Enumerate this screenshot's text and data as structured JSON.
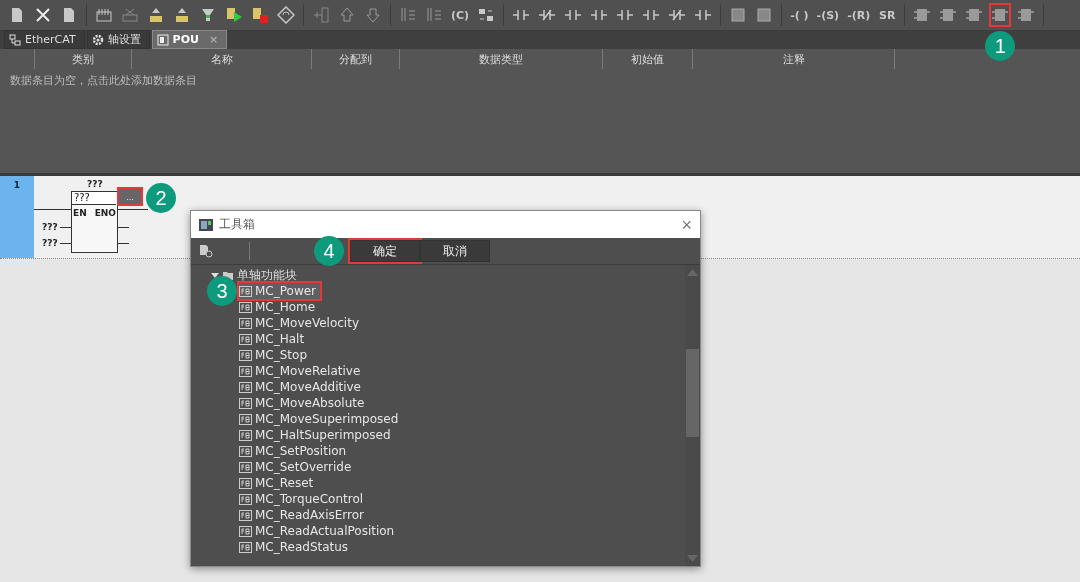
{
  "toolbar": [
    [
      {
        "kind": "doc"
      },
      {
        "kind": "close"
      },
      {
        "kind": "doc"
      }
    ],
    [
      {
        "kind": "grid"
      },
      {
        "kind": "grid-x"
      },
      {
        "kind": "tray"
      },
      {
        "kind": "tray"
      },
      {
        "kind": "filter"
      },
      {
        "kind": "play"
      },
      {
        "kind": "stop"
      },
      {
        "kind": "refresh"
      }
    ],
    [
      {
        "kind": "tree"
      },
      {
        "kind": "up"
      },
      {
        "kind": "down"
      }
    ],
    [
      {
        "kind": "sort"
      },
      {
        "kind": "sort"
      },
      {
        "kind": "text",
        "label": "(C)"
      },
      {
        "kind": "swap"
      }
    ],
    [
      {
        "kind": "contact"
      },
      {
        "kind": "contact-nc"
      },
      {
        "kind": "contact"
      },
      {
        "kind": "contact"
      },
      {
        "kind": "contact"
      },
      {
        "kind": "contact"
      },
      {
        "kind": "contact-nc"
      },
      {
        "kind": "contact"
      }
    ],
    [
      {
        "kind": "square"
      },
      {
        "kind": "square"
      }
    ],
    [
      {
        "kind": "text",
        "label": "-( )"
      },
      {
        "kind": "text",
        "label": "-(S)"
      },
      {
        "kind": "text",
        "label": "-(R)"
      },
      {
        "kind": "text",
        "label": "SR"
      }
    ],
    [
      {
        "kind": "block"
      },
      {
        "kind": "block"
      },
      {
        "kind": "block"
      },
      {
        "kind": "block",
        "highlighted": true,
        "callout": "1"
      },
      {
        "kind": "block"
      }
    ]
  ],
  "tabs": [
    {
      "label": "EtherCAT",
      "kind": "network",
      "selected": false
    },
    {
      "label": "轴设置",
      "kind": "gear",
      "selected": false
    },
    {
      "label": "POU",
      "kind": "pou",
      "selected": true,
      "close": "×"
    }
  ],
  "variables": {
    "columns": [
      "类别",
      "名称",
      "分配到",
      "数据类型",
      "初始值",
      "注释"
    ],
    "empty_message": "数据条目为空，点击此处添加数据条目"
  },
  "rung": {
    "number": "1",
    "block": {
      "instance": "???",
      "type": "???",
      "inputs": [
        "EN"
      ],
      "outputs": [
        "ENO"
      ],
      "input_values": [
        "???",
        "???"
      ],
      "browse": {
        "label": "...",
        "highlighted": true,
        "callout": "2"
      }
    }
  },
  "dialog": {
    "title": "工具箱",
    "close": "×",
    "buttons": [
      {
        "label": "确定",
        "highlighted": true,
        "callout": "4"
      },
      {
        "label": "取消",
        "highlighted": false
      }
    ],
    "tree": [
      {
        "label": "单轴功能块",
        "expanded": true,
        "children": [
          {
            "label": "MC_Power",
            "selected": true,
            "callout": "3"
          },
          {
            "label": "MC_Home",
            "selected": false
          },
          {
            "label": "MC_MoveVelocity",
            "selected": false
          },
          {
            "label": "MC_Halt",
            "selected": false
          },
          {
            "label": "MC_Stop",
            "selected": false
          },
          {
            "label": "MC_MoveRelative",
            "selected": false
          },
          {
            "label": "MC_MoveAdditive",
            "selected": false
          },
          {
            "label": "MC_MoveAbsolute",
            "selected": false
          },
          {
            "label": "MC_MoveSuperimposed",
            "selected": false
          },
          {
            "label": "MC_HaltSuperimposed",
            "selected": false
          },
          {
            "label": "MC_SetPosition",
            "selected": false
          },
          {
            "label": "MC_SetOverride",
            "selected": false
          },
          {
            "label": "MC_Reset",
            "selected": false
          },
          {
            "label": "MC_TorqueControl",
            "selected": false
          },
          {
            "label": "MC_ReadAxisError",
            "selected": false
          },
          {
            "label": "MC_ReadActualPosition",
            "selected": false
          },
          {
            "label": "MC_ReadStatus",
            "selected": false
          }
        ]
      }
    ]
  }
}
